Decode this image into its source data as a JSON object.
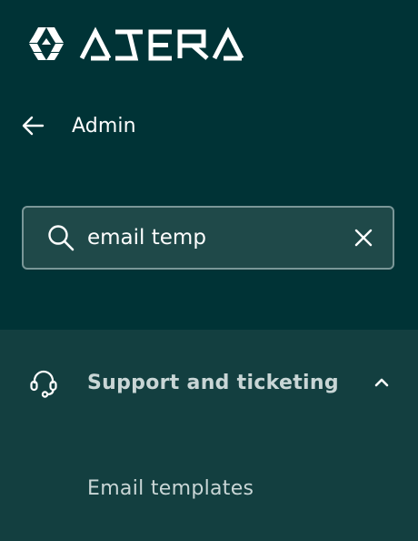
{
  "brand": {
    "name": "ATERA",
    "icon": "atera-logo-icon"
  },
  "nav": {
    "back_icon": "arrow-left-icon",
    "title": "Admin"
  },
  "search": {
    "value": "email temp",
    "placeholder": "",
    "search_icon": "search-icon",
    "clear_icon": "close-icon"
  },
  "menu": {
    "group": {
      "icon": "headset-icon",
      "label": "Support and ticketing",
      "expanded": true,
      "chevron_icon": "chevron-up-icon",
      "items": [
        {
          "label": "Email templates"
        }
      ]
    }
  },
  "colors": {
    "background": "#003336",
    "panel": "#133f40",
    "search_bg": "#1f4949",
    "search_border": "#7a9798",
    "text_primary": "#ffffff",
    "text_secondary": "#c9d6d6"
  }
}
